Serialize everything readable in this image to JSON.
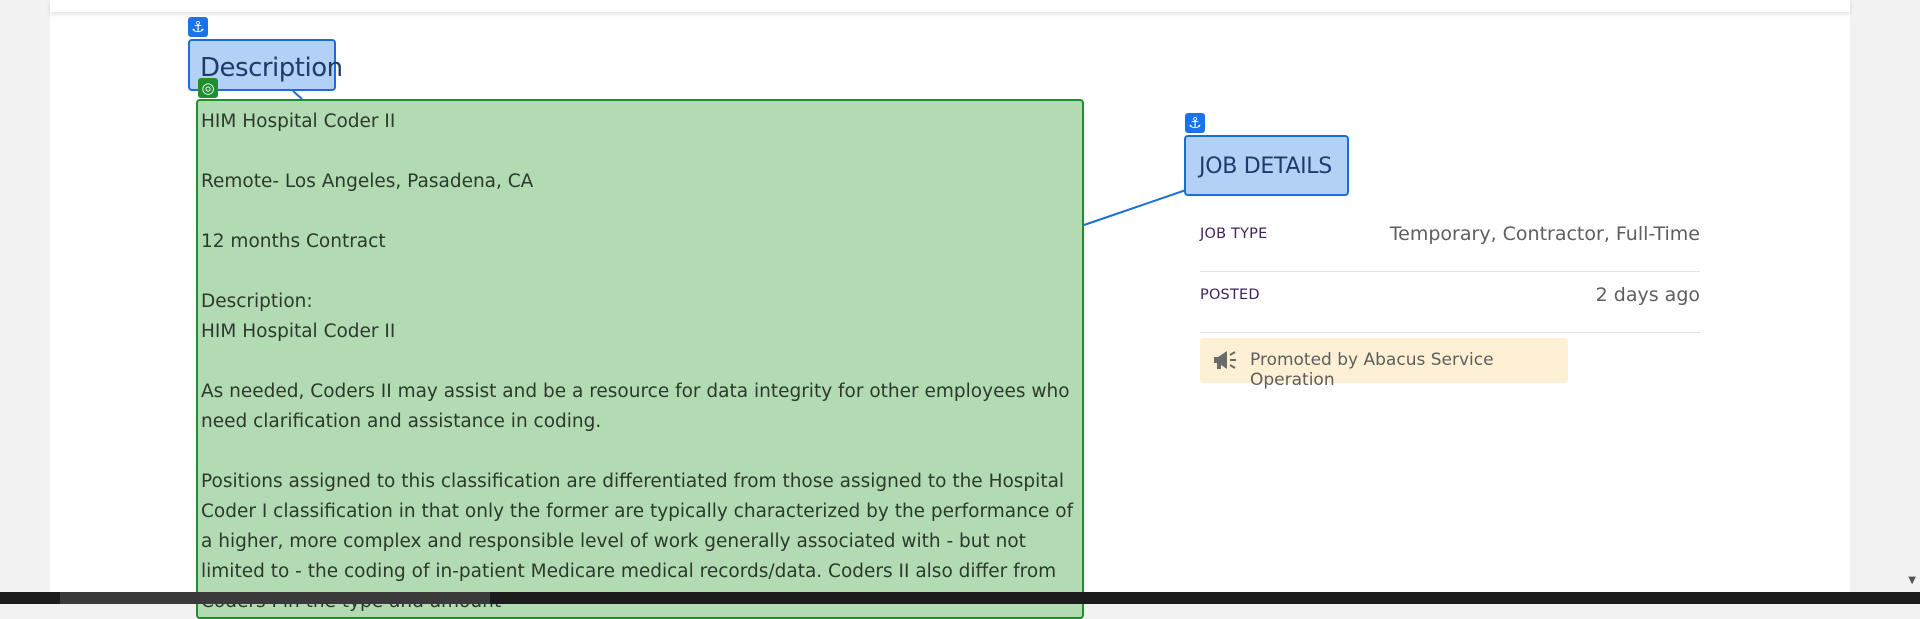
{
  "description": {
    "heading": "Description",
    "paragraphs": [
      "HIM Hospital Coder II",
      "Remote- Los Angeles, Pasadena, CA",
      "12 months Contract",
      "Description:\nHIM Hospital Coder II",
      "As needed, Coders II may assist and be a resource for data integrity for other employees who need clarification and assistance in coding.",
      "Positions assigned to this classification are differentiated from those assigned to the Hospital Coder I classification in that only the former are typically characterized by the performance of a higher, more complex and responsible level of work generally associated with - but not limited to - the coding of in-patient Medicare medical records/data. Coders II also differ from Coders I in the type and amount"
    ]
  },
  "job_details": {
    "heading": "JOB DETAILS",
    "rows": [
      {
        "label": "JOB TYPE",
        "value": "Temporary, Contractor, Full-Time"
      },
      {
        "label": "POSTED",
        "value": "2 days ago"
      }
    ],
    "promo_text": "Promoted by Abacus Service Operation"
  },
  "icons": {
    "anchor": "anchor-icon",
    "target": "target-icon",
    "megaphone": "megaphone-icon"
  },
  "colors": {
    "heading_overlay": "#b3d1f7",
    "heading_border": "#1a6ed8",
    "body_overlay": "#b2dbb3",
    "body_border": "#1e8e2e",
    "promo_bg": "#fdf0d5"
  }
}
